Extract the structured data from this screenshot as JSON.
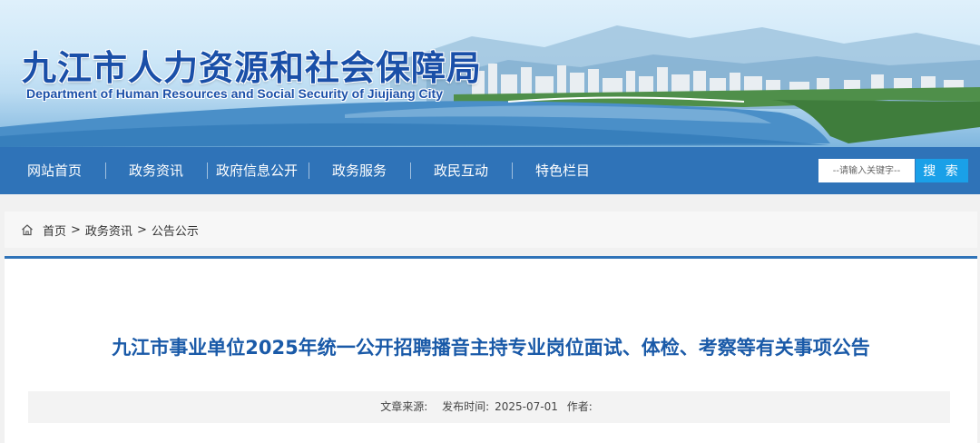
{
  "header": {
    "title": "九江市人力资源和社会保障局",
    "subtitle": "Department of Human Resources and Social Security of Jiujiang City"
  },
  "nav": {
    "items": [
      "网站首页",
      "政务资讯",
      "政府信息公开",
      "政务服务",
      "政民互动",
      "特色栏目"
    ],
    "search_placeholder": "--请输入关键字--",
    "search_label": "搜 索"
  },
  "breadcrumb": {
    "items": [
      "首页",
      "政务资讯",
      "公告公示"
    ],
    "separator": ">"
  },
  "article": {
    "title": "九江市事业单位2025年统一公开招聘播音主持专业岗位面试、体检、考察等有关事项公告",
    "source_label": "文章来源:",
    "source_value": "",
    "date_label": "发布时间:",
    "date_value": "2025-07-01",
    "author_label": "作者:",
    "author_value": ""
  },
  "colors": {
    "nav_bg": "#2f73b8",
    "search_button": "#1aa0e8",
    "title_blue": "#1a5aa8"
  },
  "icons": {
    "breadcrumb": "home-icon"
  }
}
